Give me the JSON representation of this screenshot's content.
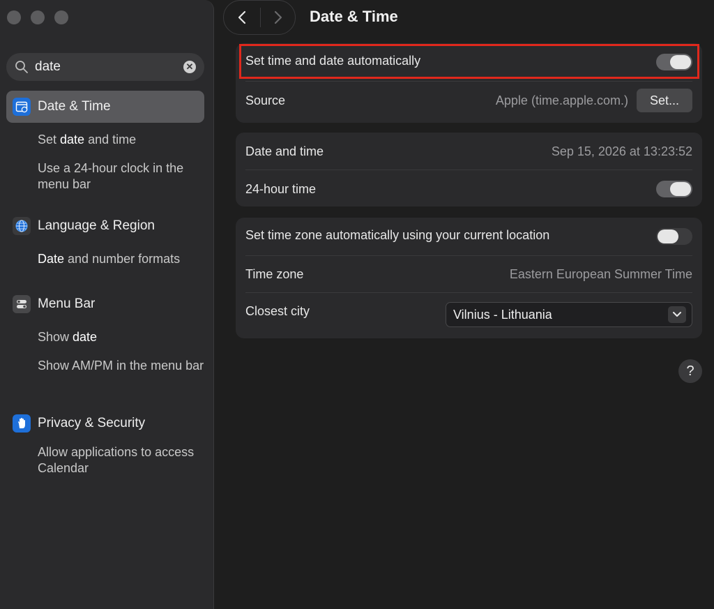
{
  "window": {
    "title": "Date & Time"
  },
  "search": {
    "query": "date"
  },
  "sidebar": {
    "items": [
      {
        "label": "Date & Time",
        "icon": "calendar-clock-icon",
        "active": true,
        "subitems": [
          {
            "label": "Set date and time",
            "highlight": "date"
          },
          {
            "label": "Use a 24-hour clock in the menu bar"
          }
        ]
      },
      {
        "label": "Language & Region",
        "icon": "globe-icon",
        "subitems": [
          {
            "label": "Date and number formats",
            "highlight": "Date"
          }
        ]
      },
      {
        "label": "Menu Bar",
        "icon": "menu-bar-toggles-icon",
        "subitems": [
          {
            "label": "Show date",
            "highlight": "date"
          },
          {
            "label": "Show AM/PM in the menu bar"
          }
        ]
      },
      {
        "label": "Privacy & Security",
        "icon": "hand-icon",
        "subitems": [
          {
            "label": "Allow applications to access Calendar"
          }
        ]
      }
    ]
  },
  "main": {
    "auto_time": {
      "label": "Set time and date automatically",
      "enabled": true
    },
    "source": {
      "label": "Source",
      "value": "Apple (time.apple.com.)",
      "button": "Set..."
    },
    "date_time": {
      "label": "Date and time",
      "value": "Sep 15, 2026 at 13:23:52"
    },
    "hour24": {
      "label": "24-hour time",
      "enabled": true
    },
    "auto_timezone": {
      "label": "Set time zone automatically using your current location",
      "enabled": false
    },
    "time_zone": {
      "label": "Time zone",
      "value": "Eastern European Summer Time"
    },
    "closest_city": {
      "label": "Closest city",
      "value": "Vilnius - Lithuania"
    },
    "help_label": "?"
  },
  "colors": {
    "highlight_border": "#e0281c",
    "accent_blue": "#0a84ff"
  }
}
